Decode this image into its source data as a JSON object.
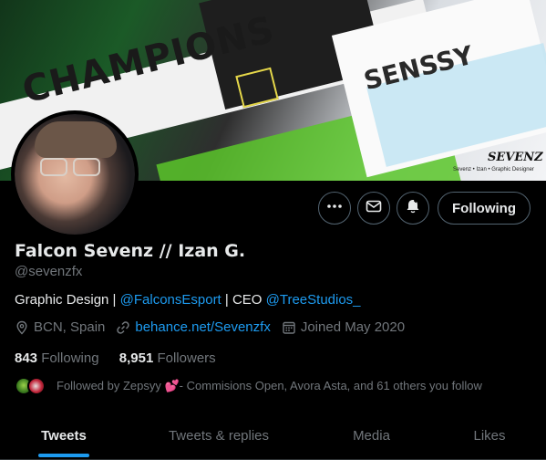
{
  "banner": {
    "champions_text": "CHAMPIONS",
    "senssy_text": "SENSSY",
    "signature": "SEVENZ",
    "signature_sub": "Sevenz • Izan • Graphic Designer"
  },
  "actions": {
    "more_icon": "more-icon",
    "mail_icon": "mail-icon",
    "notify_icon": "bell-plus-icon",
    "following_label": "Following"
  },
  "profile": {
    "name": "Falcon Sevenz // Izan G.",
    "handle": "@sevenzfx",
    "bio_prefix": "Graphic Design | ",
    "bio_link1": "@FalconsEsport",
    "bio_middle": " | CEO ",
    "bio_link2": "@TreeStudios_",
    "location": "BCN, Spain",
    "website": "behance.net/Sevenzfx",
    "joined": "Joined May 2020",
    "following_count": "843",
    "following_label": "Following",
    "followers_count": "8,951",
    "followers_label": "Followers",
    "followed_by": "Followed by Zepsyy 💕- Commisions Open, Avora Asta, and 61 others you follow"
  },
  "tabs": [
    {
      "label": "Tweets",
      "active": true
    },
    {
      "label": "Tweets & replies",
      "active": false
    },
    {
      "label": "Media",
      "active": false
    },
    {
      "label": "Likes",
      "active": false
    }
  ],
  "colors": {
    "accent": "#1d9bf0",
    "background": "#000000",
    "secondary_text": "#71767b",
    "border": "#536471"
  }
}
